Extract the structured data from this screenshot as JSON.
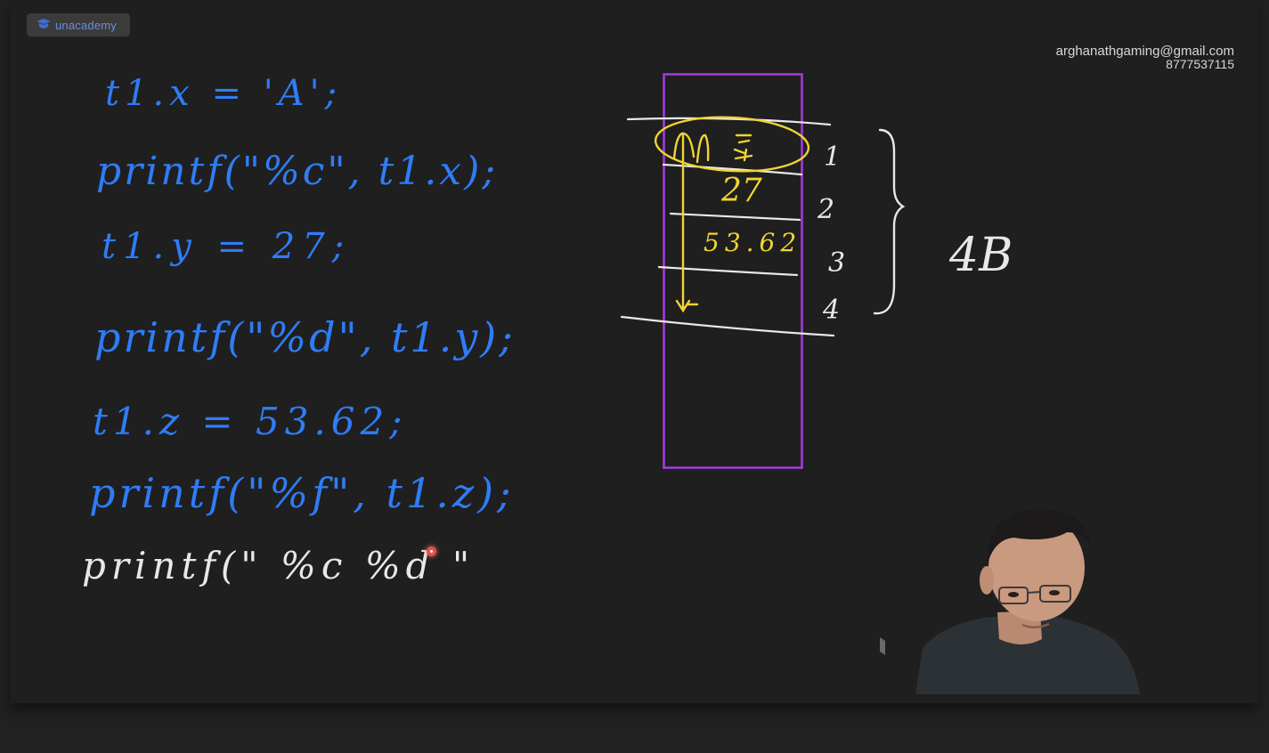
{
  "brand": {
    "name": "unacademy"
  },
  "contact": {
    "email": "arghanathgaming@gmail.com",
    "phone": "8777537115"
  },
  "code_lines": [
    "t1.x = 'A';",
    "printf(\"%c\", t1.x);",
    "t1.y = 27;",
    "printf(\"%d\", t1.y);",
    "t1.z = 53.62;",
    "printf(\"%f\", t1.z);",
    "printf(\" %c %d \""
  ],
  "diagram": {
    "cell_values": [
      "27",
      "53.62"
    ],
    "row_numbers": [
      "1",
      "2",
      "3",
      "4"
    ],
    "size_label": "4B"
  },
  "colors": {
    "board": "#1f1f1f",
    "ink_blue": "#2f7cf6",
    "ink_white": "#e8e8e8",
    "ink_yellow": "#f1d432",
    "frame_purple": "#a53be0"
  }
}
